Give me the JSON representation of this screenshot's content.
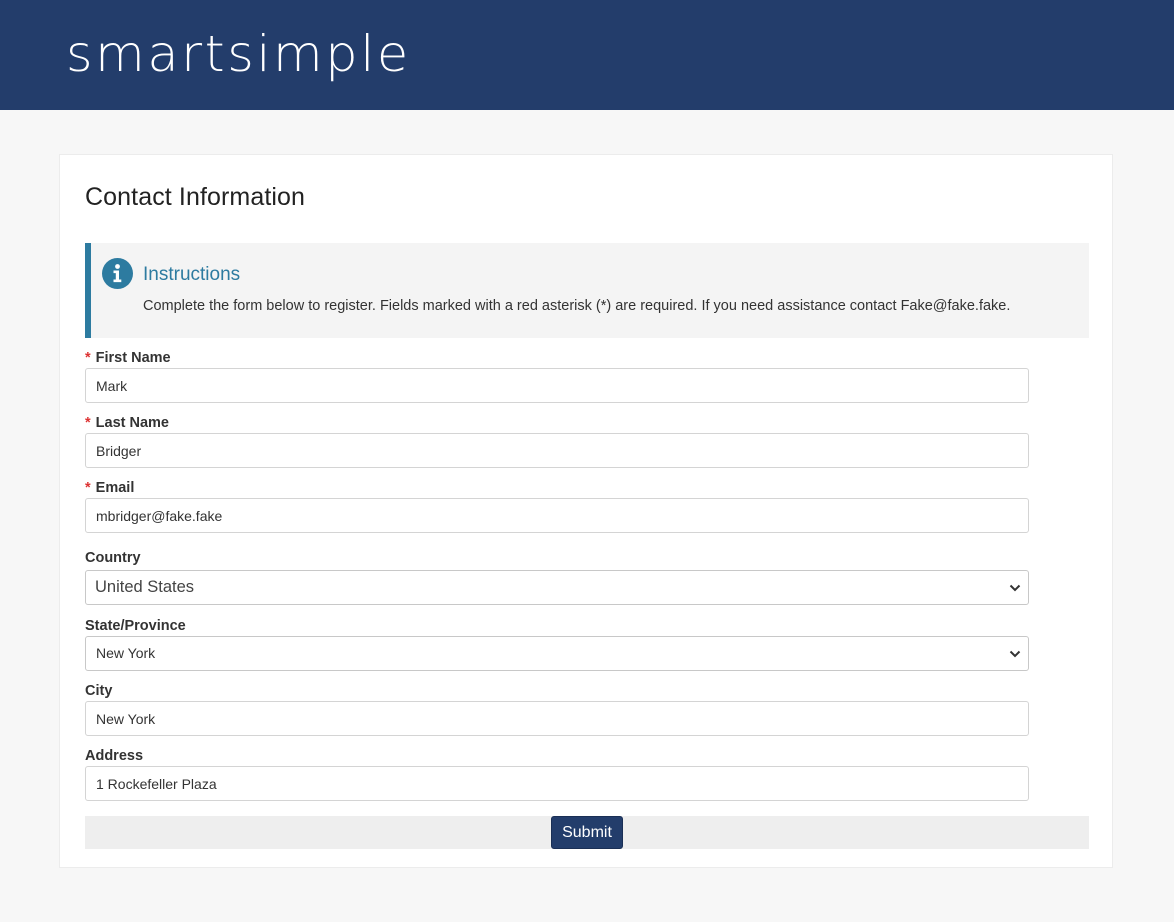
{
  "header": {
    "logo_text": "smartsimple",
    "background_color": "#233d6b"
  },
  "form": {
    "title": "Contact Information",
    "instructions": {
      "icon": "info-icon",
      "title": "Instructions",
      "body": "Complete the form below to register. Fields marked with a red asterisk (*) are required. If you need assistance contact Fake@fake.fake.",
      "accent_color": "#2d7ba0"
    },
    "required_marker": "*",
    "fields": {
      "first_name": {
        "label": "First Name",
        "value": "Mark",
        "required": true
      },
      "last_name": {
        "label": "Last Name",
        "value": "Bridger",
        "required": true
      },
      "email": {
        "label": "Email",
        "value": "mbridger@fake.fake",
        "required": true
      },
      "country": {
        "label": "Country",
        "value": "United States",
        "required": false
      },
      "state": {
        "label": "State/Province",
        "value": "New York",
        "required": false
      },
      "city": {
        "label": "City",
        "value": "New York",
        "required": false
      },
      "address": {
        "label": "Address",
        "value": "1 Rockefeller Plaza",
        "required": false
      }
    },
    "submit_label": "Submit"
  }
}
